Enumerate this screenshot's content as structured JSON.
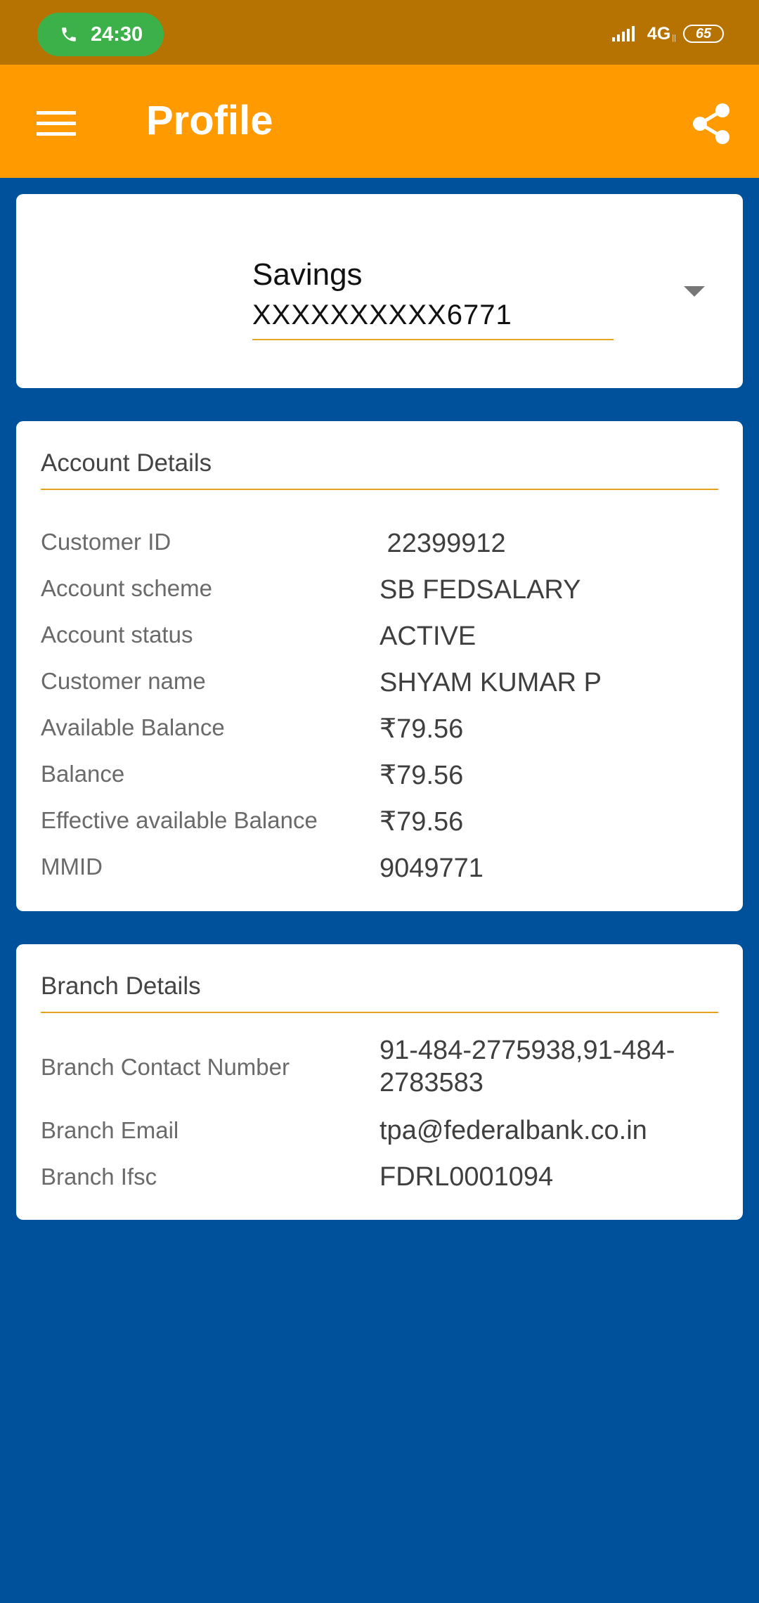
{
  "status_bar": {
    "call_time": "24:30",
    "network": "4G",
    "network_sub": "||",
    "battery": "65"
  },
  "app_bar": {
    "title": "Profile"
  },
  "account_selector": {
    "type": "Savings",
    "number": "XXXXXXXXXX6771"
  },
  "account_details": {
    "title": "Account Details",
    "rows": [
      {
        "label": "Customer ID",
        "value": " 22399912"
      },
      {
        "label": "Account scheme",
        "value": "SB FEDSALARY"
      },
      {
        "label": "Account status",
        "value": "ACTIVE"
      },
      {
        "label": "Customer name",
        "value": "SHYAM KUMAR P"
      },
      {
        "label": "Available Balance",
        "value": "₹79.56"
      },
      {
        "label": "Balance",
        "value": "₹79.56"
      },
      {
        "label": "Effective available Balance",
        "value": "₹79.56"
      },
      {
        "label": "MMID",
        "value": "9049771"
      }
    ]
  },
  "branch_details": {
    "title": "Branch Details",
    "rows": [
      {
        "label": "Branch Contact Number",
        "value_line1": "91-484-2775938,91-484-",
        "value_line2": "2783583"
      },
      {
        "label": "Branch Email",
        "value": "tpa@federalbank.co.in"
      },
      {
        "label": "Branch Ifsc",
        "value": "FDRL0001094"
      }
    ]
  },
  "colors": {
    "status_bar": "#b67302",
    "app_bar": "#ff9b00",
    "background": "#00519b",
    "accent_rule": "#e7a521",
    "call_pill": "#3cb14a"
  }
}
